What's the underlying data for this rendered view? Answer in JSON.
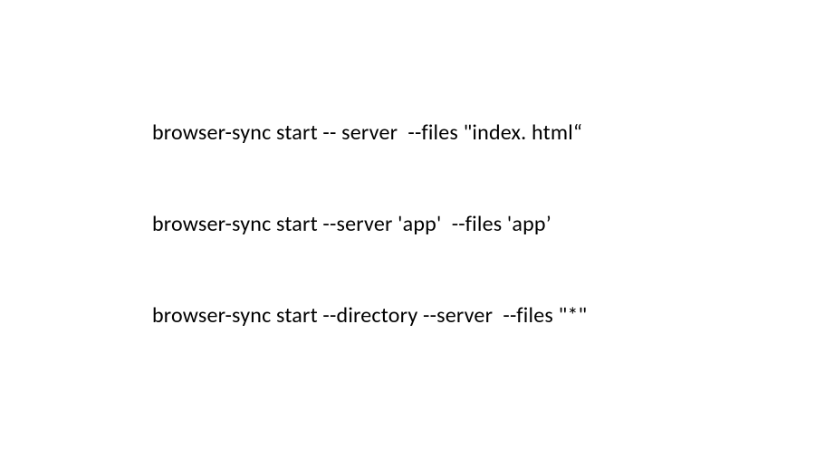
{
  "commands": {
    "line1": "browser-sync start -- server  --files \"index. html“",
    "line2": "browser-sync start --server 'app'  --files 'app’",
    "line3": "browser-sync start --directory --server  --files \"*\""
  }
}
